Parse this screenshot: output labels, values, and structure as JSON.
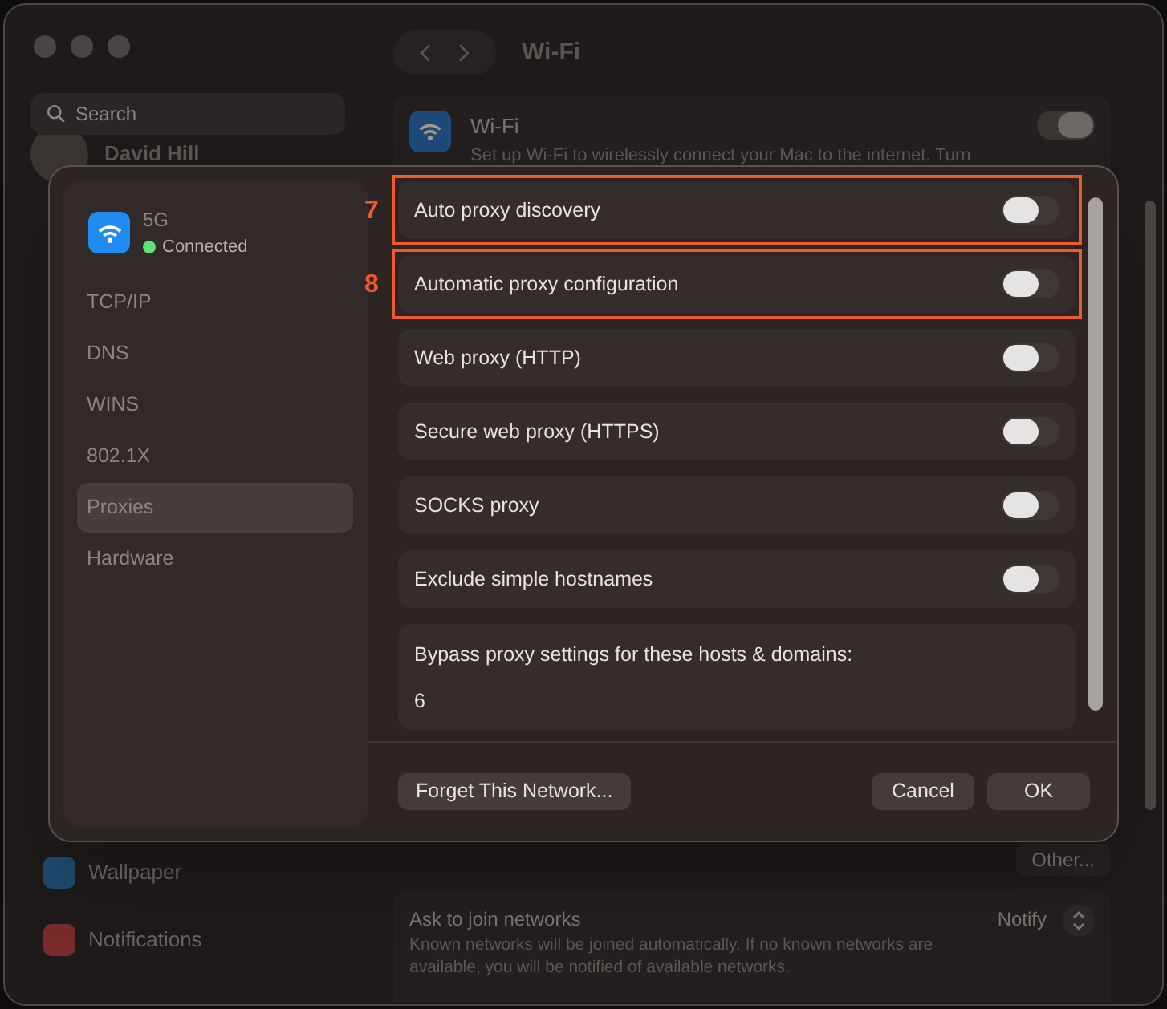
{
  "window": {
    "title": "Wi-Fi"
  },
  "sidebar": {
    "search": {
      "placeholder": "Search"
    },
    "user": {
      "name": "David Hill"
    },
    "items": [
      {
        "label": "Wallpaper",
        "color": "#1d4a6e"
      },
      {
        "label": "Notifications",
        "color": "#7a2c2c"
      }
    ]
  },
  "wifi_row": {
    "title": "Wi-Fi",
    "description": "Set up Wi-Fi to wirelessly connect your Mac to the internet. Turn",
    "on": true
  },
  "other_button": "Other...",
  "ask_to_join": {
    "title": "Ask to join networks",
    "description": "Known networks will be joined automatically. If no known networks are available, you will be notified of available networks.",
    "value": "Notify"
  },
  "sheet": {
    "network": {
      "name": "5G",
      "status": "Connected",
      "connected": true
    },
    "tabs": [
      {
        "label": "TCP/IP",
        "selected": false
      },
      {
        "label": "DNS",
        "selected": false
      },
      {
        "label": "WINS",
        "selected": false
      },
      {
        "label": "802.1X",
        "selected": false
      },
      {
        "label": "Proxies",
        "selected": true
      },
      {
        "label": "Hardware",
        "selected": false
      }
    ],
    "options": [
      {
        "label": "Auto proxy discovery",
        "on": false,
        "callout": "7"
      },
      {
        "label": "Automatic proxy configuration",
        "on": false,
        "callout": "8"
      },
      {
        "label": "Web proxy (HTTP)",
        "on": false
      },
      {
        "label": "Secure web proxy (HTTPS)",
        "on": false
      },
      {
        "label": "SOCKS proxy",
        "on": false
      },
      {
        "label": "Exclude simple hostnames",
        "on": false
      }
    ],
    "bypass": {
      "label": "Bypass proxy settings for these hosts & domains:",
      "value": "6"
    },
    "buttons": {
      "forget": "Forget This Network...",
      "cancel": "Cancel",
      "ok": "OK"
    }
  }
}
